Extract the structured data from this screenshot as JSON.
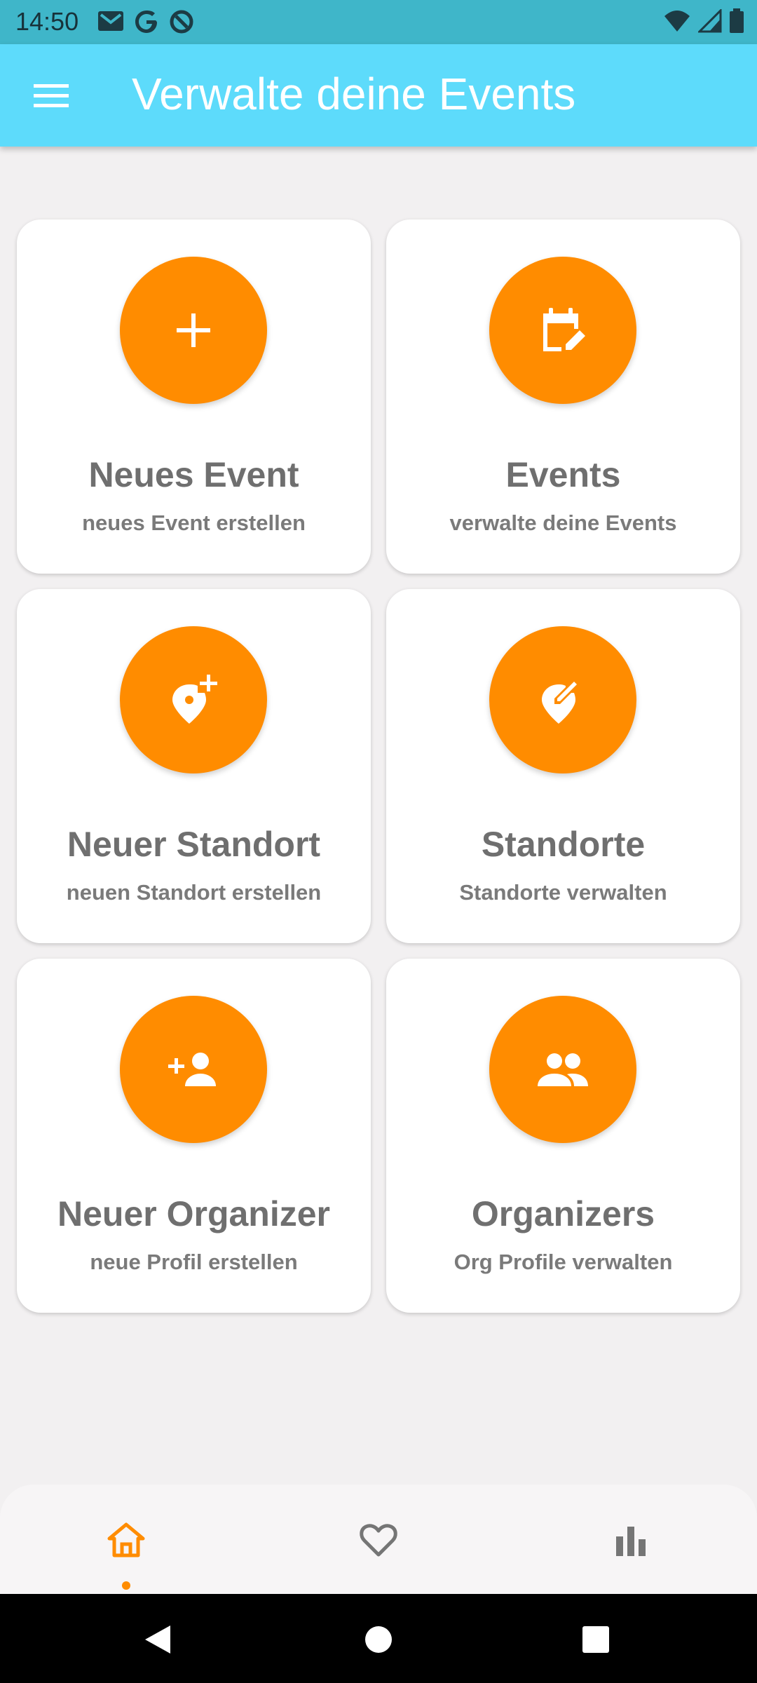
{
  "status_bar": {
    "time": "14:50",
    "left_icons": [
      "gmail-icon",
      "google-icon",
      "at-sign-icon"
    ],
    "right_icons": [
      "wifi-icon",
      "signal-icon",
      "battery-icon"
    ]
  },
  "app_bar": {
    "title": "Verwalte deine Events",
    "menu_icon": "hamburger-menu-icon"
  },
  "cards": [
    {
      "title": "Neues Event",
      "subtitle": "neues Event erstellen",
      "icon": "plus-icon"
    },
    {
      "title": "Events",
      "subtitle": "verwalte deine Events",
      "icon": "calendar-edit-icon"
    },
    {
      "title": "Neuer Standort",
      "subtitle": "neuen Standort erstellen",
      "icon": "location-add-icon"
    },
    {
      "title": "Standorte",
      "subtitle": "Standorte verwalten",
      "icon": "location-edit-icon"
    },
    {
      "title": "Neuer Organizer",
      "subtitle": "neue Profil erstellen",
      "icon": "person-add-icon"
    },
    {
      "title": "Organizers",
      "subtitle": "Org Profile verwalten",
      "icon": "people-icon"
    }
  ],
  "bottom_nav": {
    "items": [
      {
        "name": "home",
        "icon": "home-icon",
        "active": true
      },
      {
        "name": "favorites",
        "icon": "heart-icon",
        "active": false
      },
      {
        "name": "stats",
        "icon": "bar-chart-icon",
        "active": false
      }
    ]
  },
  "system_nav": [
    "back-icon",
    "home-circle-icon",
    "recents-icon"
  ],
  "colors": {
    "accent": "#ff8c00",
    "app_bar": "#5ddbfb",
    "status_bar": "#3fb6c9",
    "background": "#f2f0f1",
    "text": "#6f6f6f"
  }
}
